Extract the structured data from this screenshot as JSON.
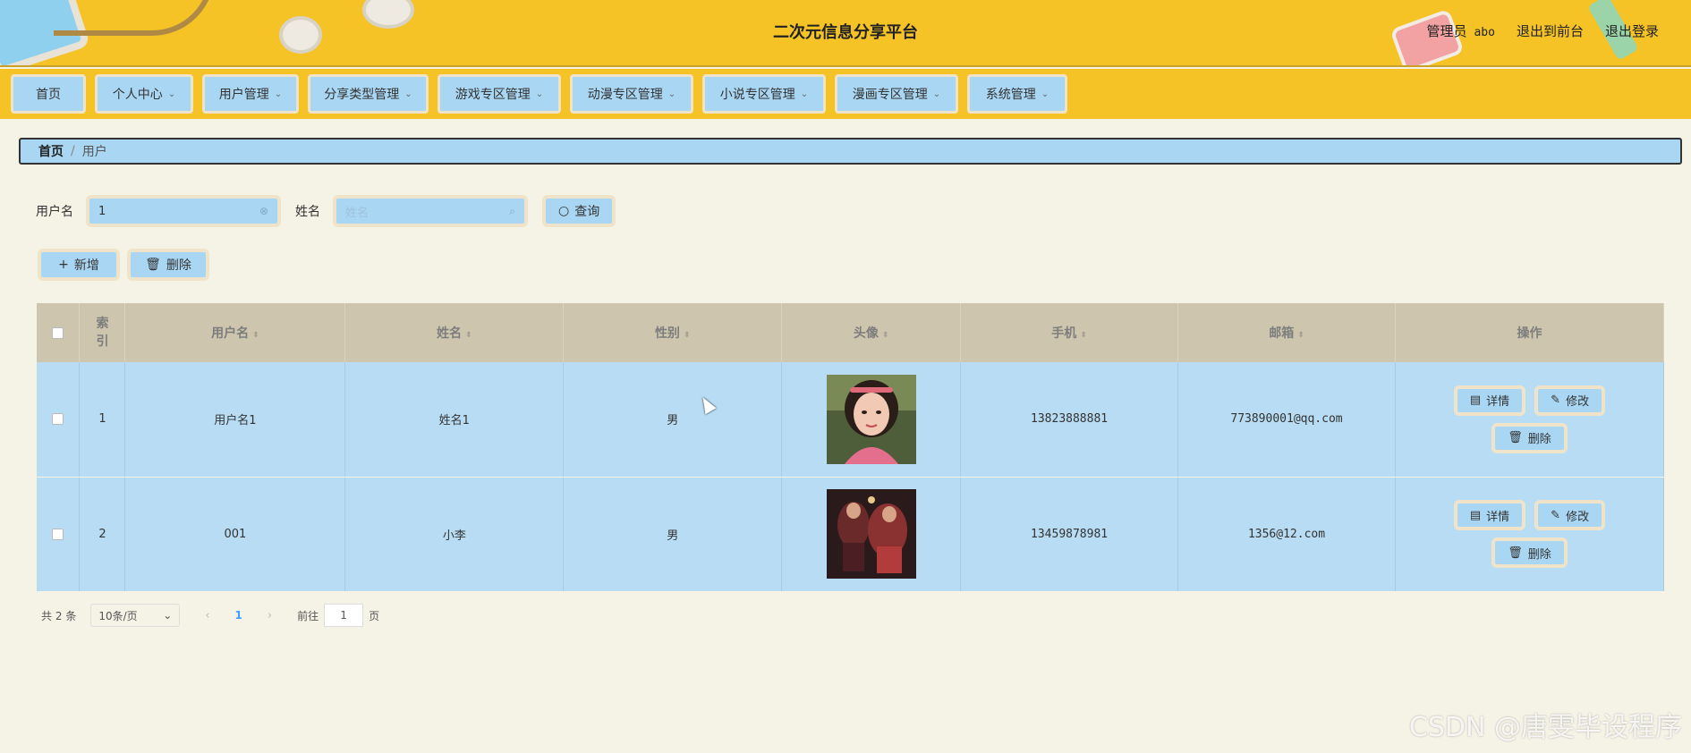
{
  "header": {
    "title": "二次元信息分享平台",
    "admin_role": "管理员",
    "admin_name": "abo",
    "exit_front": "退出到前台",
    "logout": "退出登录"
  },
  "nav": [
    {
      "label": "首页",
      "dropdown": false
    },
    {
      "label": "个人中心",
      "dropdown": true
    },
    {
      "label": "用户管理",
      "dropdown": true
    },
    {
      "label": "分享类型管理",
      "dropdown": true
    },
    {
      "label": "游戏专区管理",
      "dropdown": true
    },
    {
      "label": "动漫专区管理",
      "dropdown": true
    },
    {
      "label": "小说专区管理",
      "dropdown": true
    },
    {
      "label": "漫画专区管理",
      "dropdown": true
    },
    {
      "label": "系统管理",
      "dropdown": true
    }
  ],
  "breadcrumb": {
    "home": "首页",
    "current": "用户"
  },
  "search": {
    "username_label": "用户名",
    "username_value": "1",
    "name_label": "姓名",
    "name_placeholder": "姓名",
    "query_button": "查询"
  },
  "actions": {
    "add": "新增",
    "delete": "删除"
  },
  "table": {
    "headers": {
      "index": "索引",
      "username": "用户名",
      "name": "姓名",
      "gender": "性别",
      "avatar": "头像",
      "phone": "手机",
      "email": "邮箱",
      "ops": "操作"
    },
    "rows": [
      {
        "index": "1",
        "username": "用户名1",
        "name": "姓名1",
        "gender": "男",
        "phone": "13823888881",
        "email": "773890001@qq.com"
      },
      {
        "index": "2",
        "username": "001",
        "name": "小李",
        "gender": "男",
        "phone": "13459878981",
        "email": "1356@12.com"
      }
    ],
    "row_buttons": {
      "detail": "详情",
      "edit": "修改",
      "delete": "删除"
    }
  },
  "pagination": {
    "total_prefix": "共",
    "total": "2",
    "total_suffix": "条",
    "page_size": "10条/页",
    "current_page": "1",
    "goto_prefix": "前往",
    "goto_value": "1",
    "goto_suffix": "页"
  },
  "watermark": "CSDN @唐雯毕设程序",
  "colors": {
    "header": "#f5c326",
    "accent": "#a9d6f3",
    "background": "#f5f2e6"
  }
}
